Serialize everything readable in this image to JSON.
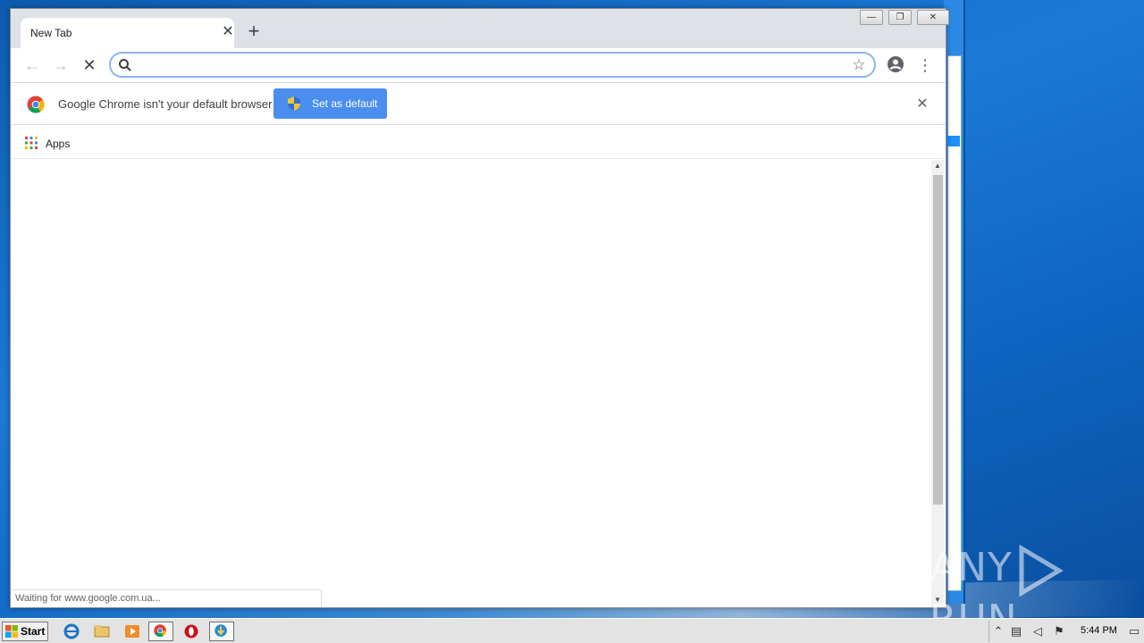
{
  "browser": {
    "tab_title": "New Tab",
    "tab_close_glyph": "✕",
    "new_tab_glyph": "+",
    "address_value": "",
    "address_placeholder": "",
    "window_controls": {
      "minimize": "—",
      "restore": "❐",
      "close": "✕"
    },
    "nav": {
      "back": "←",
      "forward": "→",
      "stop": "✕"
    },
    "icons": [
      "search-icon",
      "star-icon",
      "profile-icon",
      "menu-icon"
    ]
  },
  "infobar": {
    "message": "Google Chrome isn't your default browser",
    "button_label": "Set as default",
    "close_glyph": "✕"
  },
  "bookmarks": {
    "apps_label": "Apps"
  },
  "status": {
    "text": "Waiting for www.google.com.ua..."
  },
  "watermark": {
    "left": "ANY",
    "right": "RUN"
  },
  "taskbar": {
    "start_label": "Start",
    "apps": [
      "internet-explorer-icon",
      "file-explorer-icon",
      "media-player-icon",
      "chrome-icon",
      "opera-icon",
      "installer-icon"
    ],
    "clock": "5:44 PM"
  },
  "colors": {
    "accent": "#4a8ef0",
    "desktop": "#1b7ad6",
    "titlebar": "#dee1e6"
  }
}
